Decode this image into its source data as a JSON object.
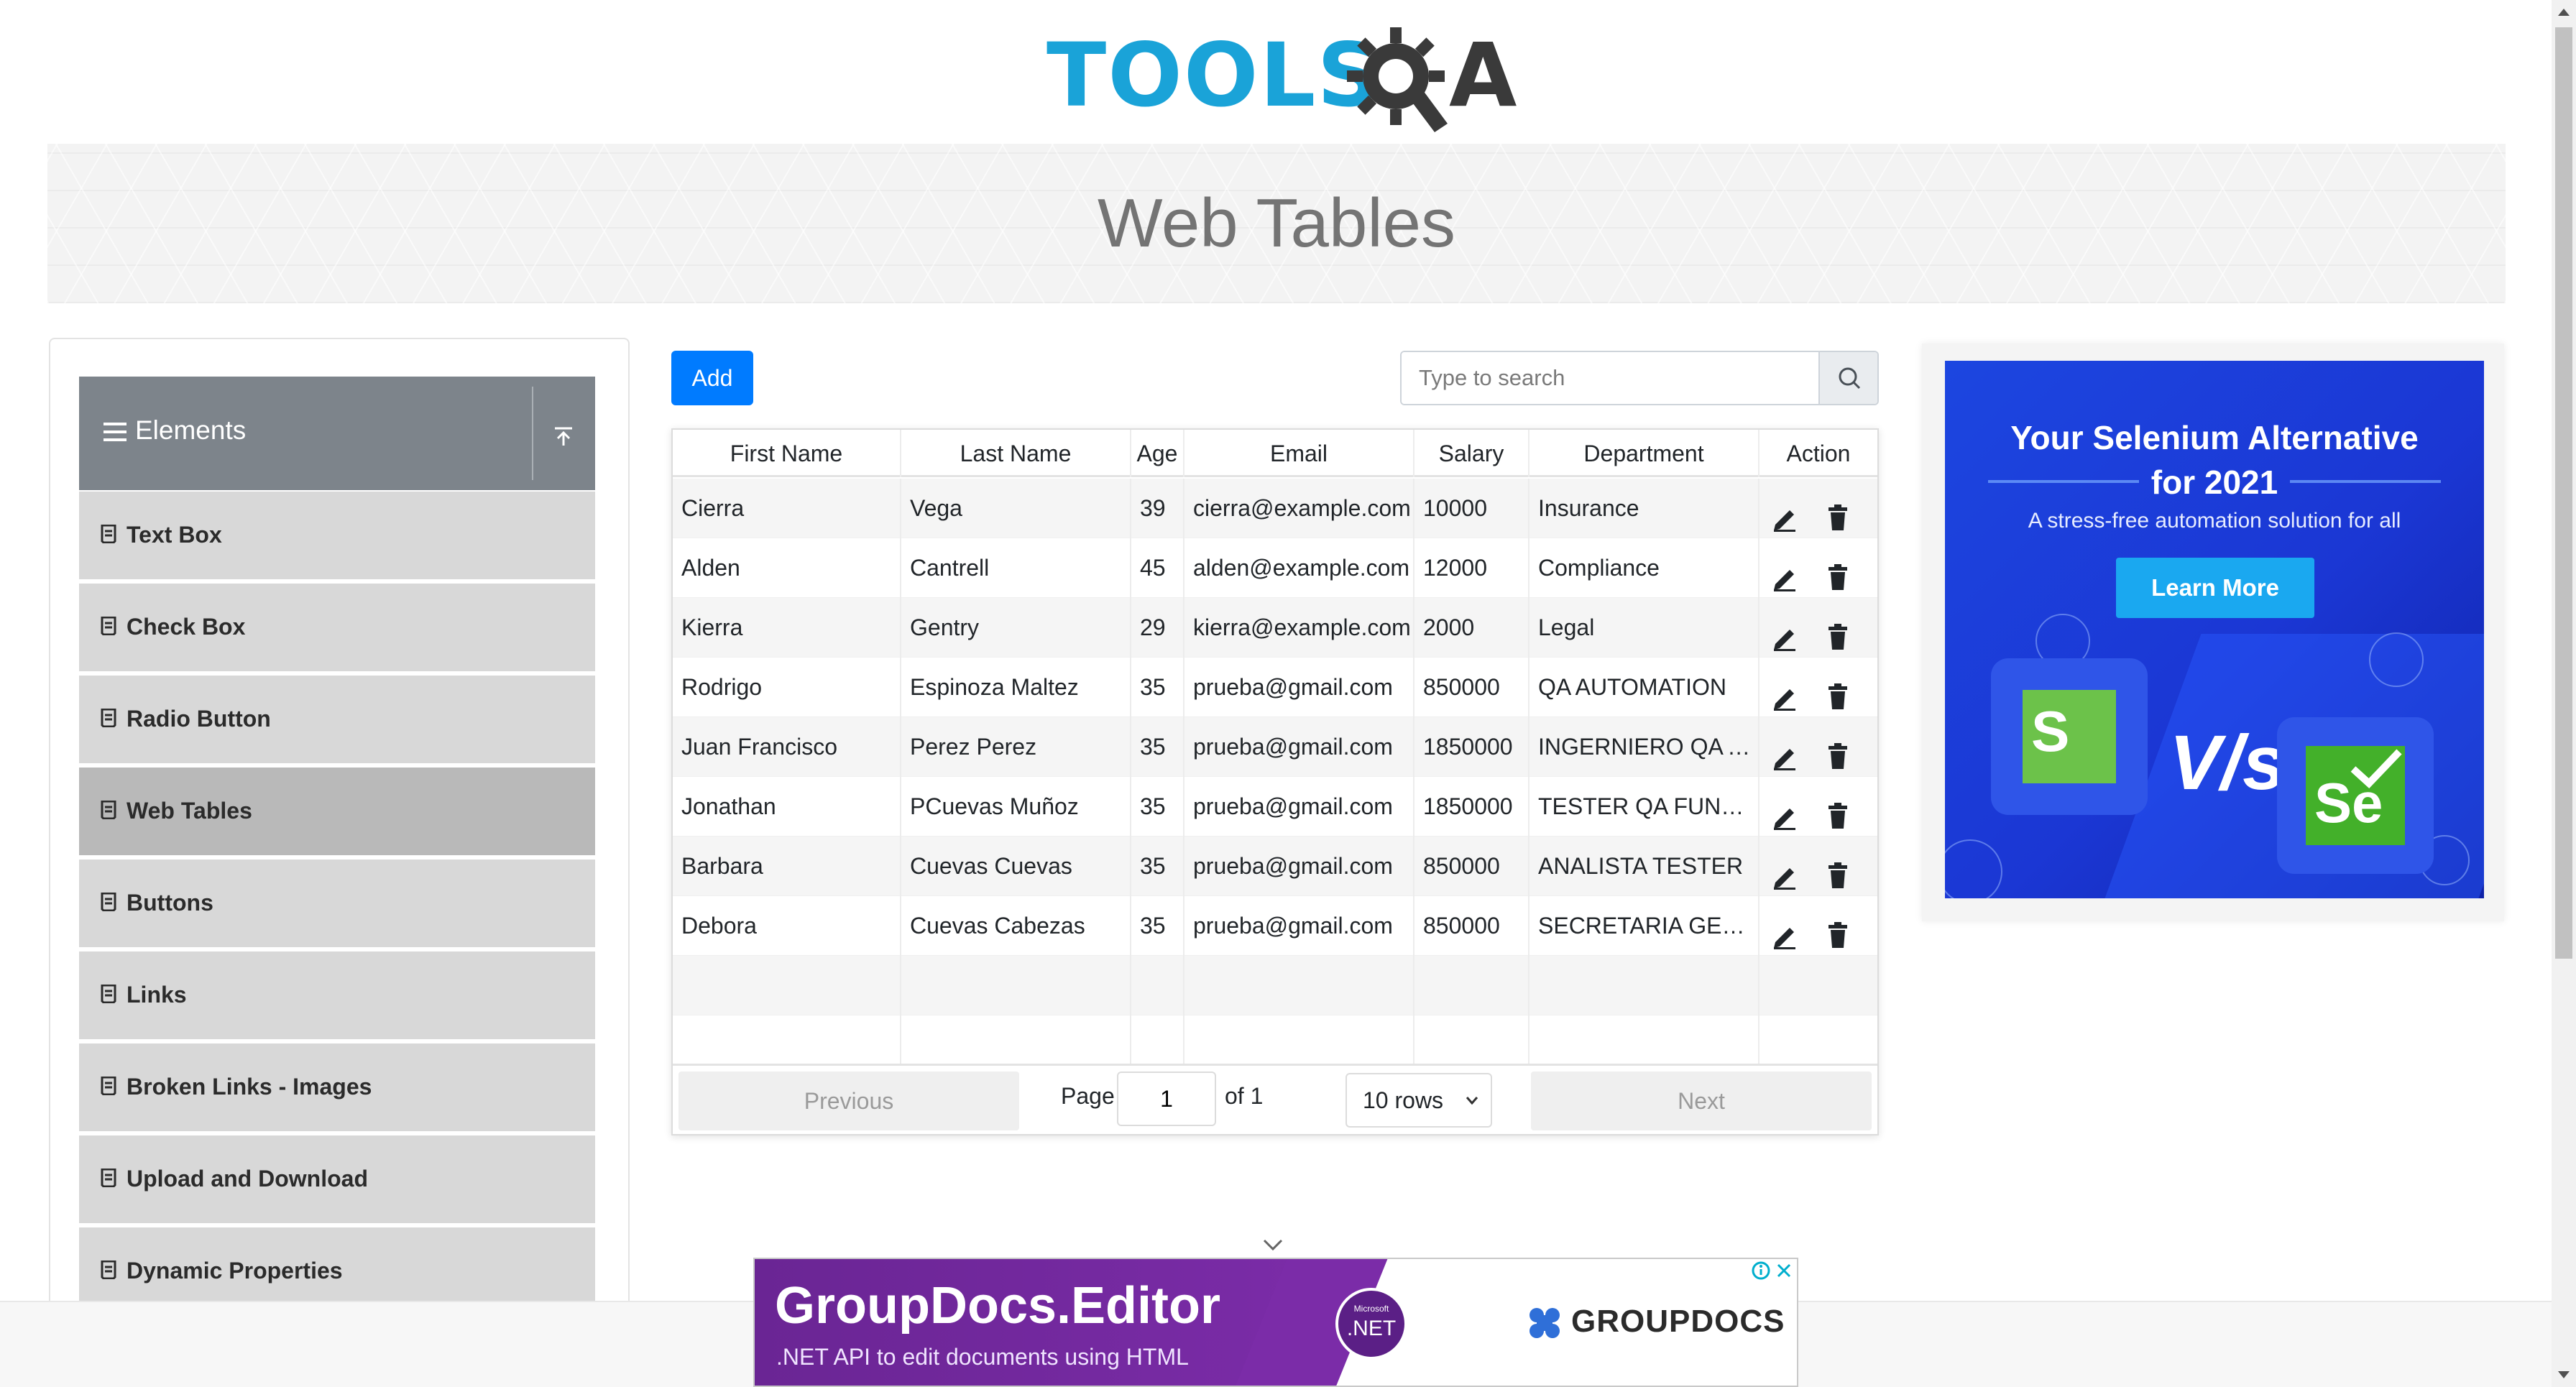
{
  "logo": {
    "text": "TOOLS",
    "suffix": "A",
    "colors": {
      "tools": "#1aa3d8",
      "qa": "#3a3a3a"
    }
  },
  "page": {
    "title": "Web Tables"
  },
  "sidebar": {
    "group_title": "Elements",
    "items": [
      {
        "label": "Text Box",
        "active": false
      },
      {
        "label": "Check Box",
        "active": false
      },
      {
        "label": "Radio Button",
        "active": false
      },
      {
        "label": "Web Tables",
        "active": true
      },
      {
        "label": "Buttons",
        "active": false
      },
      {
        "label": "Links",
        "active": false
      },
      {
        "label": "Broken Links - Images",
        "active": false
      },
      {
        "label": "Upload and Download",
        "active": false
      },
      {
        "label": "Dynamic Properties",
        "active": false
      }
    ]
  },
  "toolbar": {
    "add_label": "Add",
    "search_placeholder": "Type to search"
  },
  "table": {
    "headers": [
      "First Name",
      "Last Name",
      "Age",
      "Email",
      "Salary",
      "Department",
      "Action"
    ],
    "rows": [
      [
        "Cierra",
        "Vega",
        "39",
        "cierra@example.com",
        "10000",
        "Insurance"
      ],
      [
        "Alden",
        "Cantrell",
        "45",
        "alden@example.com",
        "12000",
        "Compliance"
      ],
      [
        "Kierra",
        "Gentry",
        "29",
        "kierra@example.com",
        "2000",
        "Legal"
      ],
      [
        "Rodrigo",
        "Espinoza Maltez",
        "35",
        "prueba@gmail.com",
        "850000",
        "QA AUTOMATION"
      ],
      [
        "Juan Francisco",
        "Perez Perez",
        "35",
        "prueba@gmail.com",
        "1850000",
        "INGERNIERO QA A..."
      ],
      [
        "Jonathan",
        "PCuevas Muñoz",
        "35",
        "prueba@gmail.com",
        "1850000",
        "TESTER QA FUNCI..."
      ],
      [
        "Barbara",
        "Cuevas Cuevas",
        "35",
        "prueba@gmail.com",
        "850000",
        "ANALISTA TESTER"
      ],
      [
        "Debora",
        "Cuevas Cabezas",
        "35",
        "prueba@gmail.com",
        "850000",
        "SECRETARIA GERE..."
      ],
      [
        "",
        "",
        "",
        "",
        "",
        ""
      ],
      [
        "",
        "",
        "",
        "",
        "",
        ""
      ]
    ]
  },
  "pager": {
    "previous_label": "Previous",
    "page_label": "Page",
    "page_value": "1",
    "of_label": "of 1",
    "rows_value": "10 rows",
    "next_label": "Next"
  },
  "right_ad": {
    "title_line1": "Your Selenium Alternative",
    "title_line2": "for 2021",
    "subtitle": "A stress-free automation solution for all",
    "button_label": "Learn More",
    "vs_text": "V/s",
    "k_letter": "S",
    "se_letter": "Se"
  },
  "bottom_ad": {
    "title": "GroupDocs.Editor",
    "subtitle": ".NET API to edit documents using HTML",
    "badge_small": "Microsoft",
    "badge_text": ".NET",
    "brand": "GROUPDOCS"
  },
  "icons": [
    "menu-icon",
    "upload-icon",
    "document-icon",
    "search-icon",
    "pencil-icon",
    "trash-icon",
    "chevron-down-icon",
    "info-icon",
    "close-icon"
  ]
}
